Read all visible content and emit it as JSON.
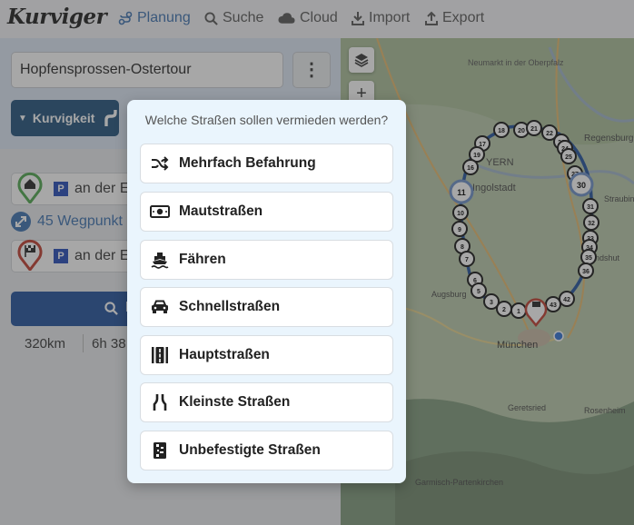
{
  "app": {
    "logo": "Kurviger"
  },
  "nav": [
    {
      "label": "Planung",
      "icon": "route-icon",
      "active": true
    },
    {
      "label": "Suche",
      "icon": "search-icon",
      "active": false
    },
    {
      "label": "Cloud",
      "icon": "cloud-icon",
      "active": false
    },
    {
      "label": "Import",
      "icon": "import-icon",
      "active": false
    },
    {
      "label": "Export",
      "icon": "export-icon",
      "active": false
    }
  ],
  "sidebar": {
    "route_name": "Hopfensprossen-Ostertour",
    "menu_icon": "⋮",
    "curviness_button": "Kurvigkeit",
    "start_text": "an der E",
    "waypoint_count": "45 Wegpunkt",
    "end_text": "an der E",
    "parking_badge": "P",
    "distance": "320km",
    "duration": "6h 38",
    "search_button_partial": "I"
  },
  "map": {
    "labels": [
      "Neumarkt in der Oberpfalz",
      "Regensburg",
      "YERN",
      "Ingolstadt",
      "München",
      "Geretsried",
      "Rosenheim",
      "Garmisch-Partenkirchen",
      "Straubing",
      "Landshut",
      "Augsburg"
    ],
    "markers": [
      "1",
      "2",
      "3",
      "4",
      "5",
      "6",
      "7",
      "8",
      "9",
      "10",
      "11",
      "16",
      "17",
      "18",
      "19",
      "20",
      "21",
      "22",
      "23",
      "24",
      "25",
      "27",
      "30",
      "31",
      "32",
      "33",
      "34",
      "35",
      "36",
      "42",
      "43"
    ]
  },
  "popup": {
    "title": "Welche Straßen sollen vermieden werden?",
    "options": [
      {
        "label": "Mehrfach Befahrung",
        "icon": "shuffle-icon"
      },
      {
        "label": "Mautstraßen",
        "icon": "toll-money-icon"
      },
      {
        "label": "Fähren",
        "icon": "ferry-icon"
      },
      {
        "label": "Schnellstraßen",
        "icon": "car-icon"
      },
      {
        "label": "Hauptstraßen",
        "icon": "main-road-icon"
      },
      {
        "label": "Kleinste Straßen",
        "icon": "narrow-road-icon"
      },
      {
        "label": "Unbefestigte Straßen",
        "icon": "unpaved-road-icon"
      }
    ]
  },
  "colors": {
    "accent": "#1e4f7a",
    "link": "#3a6fb0",
    "start_pin": "#4ca64c",
    "end_pin": "#c0392b"
  }
}
